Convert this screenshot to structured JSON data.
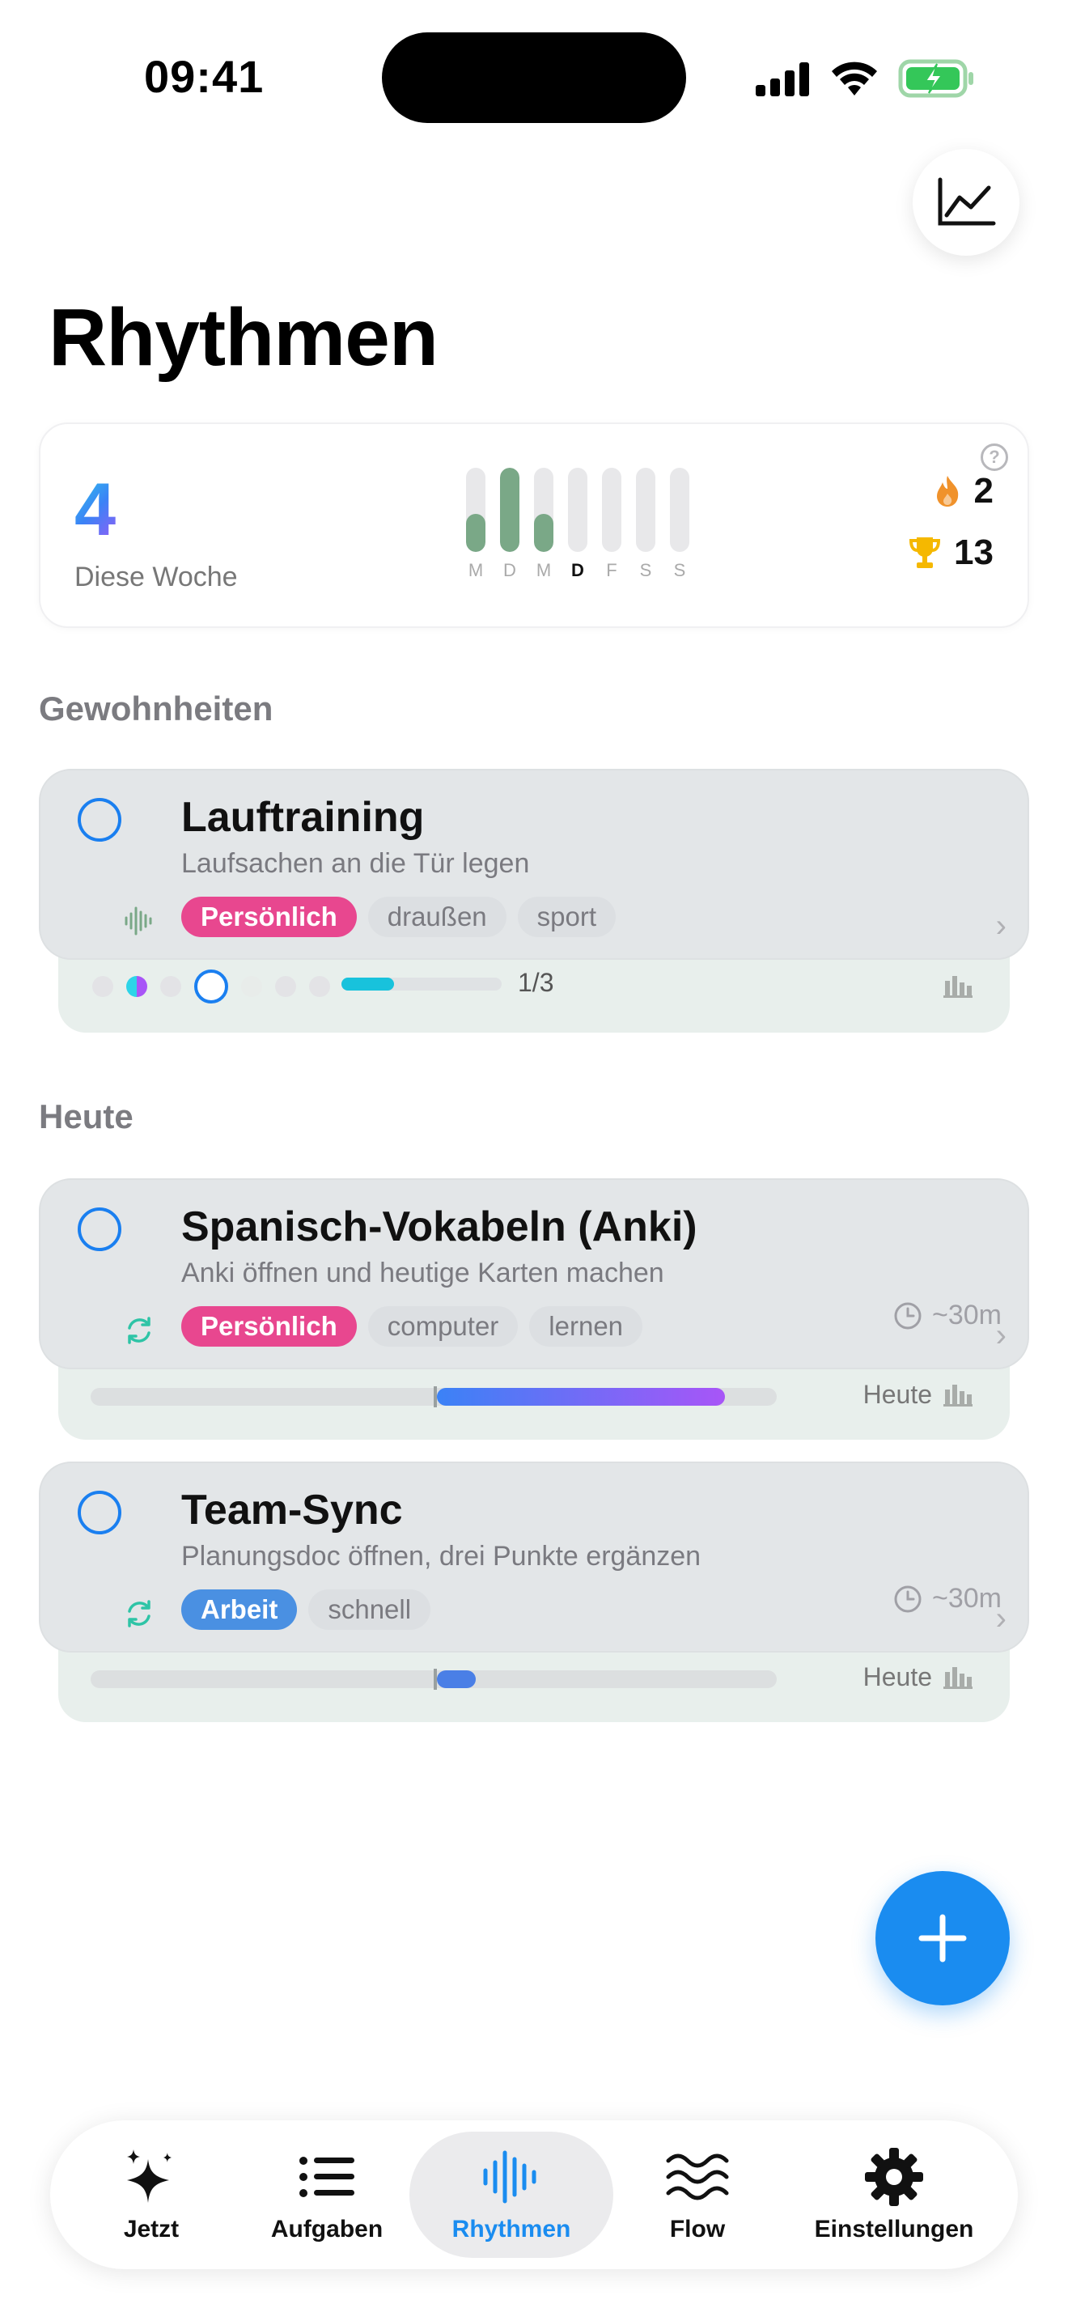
{
  "status": {
    "time": "09:41"
  },
  "page": {
    "title": "Rhythmen"
  },
  "summary": {
    "count": "4",
    "label": "Diese Woche",
    "days": [
      {
        "letter": "M",
        "level": 0.45,
        "today": false
      },
      {
        "letter": "D",
        "level": 1.0,
        "today": false
      },
      {
        "letter": "M",
        "level": 0.45,
        "today": false
      },
      {
        "letter": "D",
        "level": 0,
        "today": true
      },
      {
        "letter": "F",
        "level": 0,
        "today": false
      },
      {
        "letter": "S",
        "level": 0,
        "today": false
      },
      {
        "letter": "S",
        "level": 0,
        "today": false
      }
    ],
    "help": "?",
    "streak": "2",
    "trophies": "13"
  },
  "sections": {
    "habits": "Gewohnheiten",
    "today": "Heute"
  },
  "habit": {
    "title": "Lauftraining",
    "description": "Laufsachen an die Tür legen",
    "tags": [
      "Persönlich",
      "draußen",
      "sport"
    ],
    "primary_color": "#e8478f",
    "progress_text": "1/3",
    "progress": 0.33
  },
  "tasks": [
    {
      "title": "Spanisch-Vokabeln (Anki)",
      "description": "Anki öffnen und heutige Karten machen",
      "tags": [
        "Persönlich",
        "computer",
        "lernen"
      ],
      "primary_color": "#e8478f",
      "duration": "~30m",
      "due": "Heute"
    },
    {
      "title": "Team-Sync",
      "description": "Planungsdoc öffnen, drei Punkte ergänzen",
      "tags": [
        "Arbeit",
        "schnell"
      ],
      "primary_color": "#4a90e2",
      "duration": "~30m",
      "due": "Heute"
    }
  ],
  "tabs": [
    {
      "label": "Jetzt",
      "icon": "sparkles-icon"
    },
    {
      "label": "Aufgaben",
      "icon": "list-icon"
    },
    {
      "label": "Rhythmen",
      "icon": "waveform-icon",
      "active": true
    },
    {
      "label": "Flow",
      "icon": "waves-icon"
    },
    {
      "label": "Einstellungen",
      "icon": "gear-icon"
    }
  ],
  "colors": {
    "accent": "#1a8cf0",
    "habit_bar": "#7aa887",
    "streak": "#f0922b",
    "trophy": "#f5b800"
  }
}
